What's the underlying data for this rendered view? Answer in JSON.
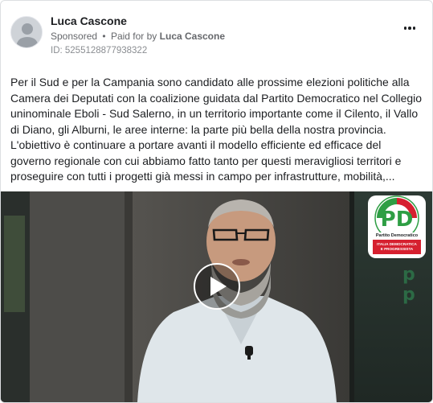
{
  "post": {
    "author_name": "Luca Cascone",
    "sponsored_label": "Sponsored",
    "separator": "•",
    "paid_for_label": "Paid for by",
    "paid_for_name": "Luca Cascone",
    "library_id": "ID: 5255128877938322",
    "more_icon": "more-horizontal-icon",
    "text": "Per il Sud e per la Campania sono candidato alle prossime elezioni politiche alla Camera dei Deputati con la coalizione guidata dal Partito Democratico nel Collegio uninominale Eboli - Sud Salerno, in un territorio importante come il Cilento, il Vallo di Diano, gli Alburni, le aree interne: la parte più bella della nostra provincia. L'obiettivo è continuare a portare avanti il modello efficiente ed efficace del governo regionale con cui abbiamo fatto tanto per questi meravigliosi territori e proseguire con tutti i progetti già messi in campo per infrastrutture, mobilità,..."
  },
  "video": {
    "play_icon": "play-icon",
    "logo": {
      "letters": "PD",
      "subtitle": "Partito Democratico",
      "banner": [
        "ITALIA DEMOCRATICA",
        "E PROGRESSISTA"
      ]
    }
  },
  "colors": {
    "text": "#1c1e21",
    "muted": "#65676b",
    "pd_green": "#2e9e44",
    "pd_red": "#d6202f",
    "border": "#dddfe2"
  }
}
